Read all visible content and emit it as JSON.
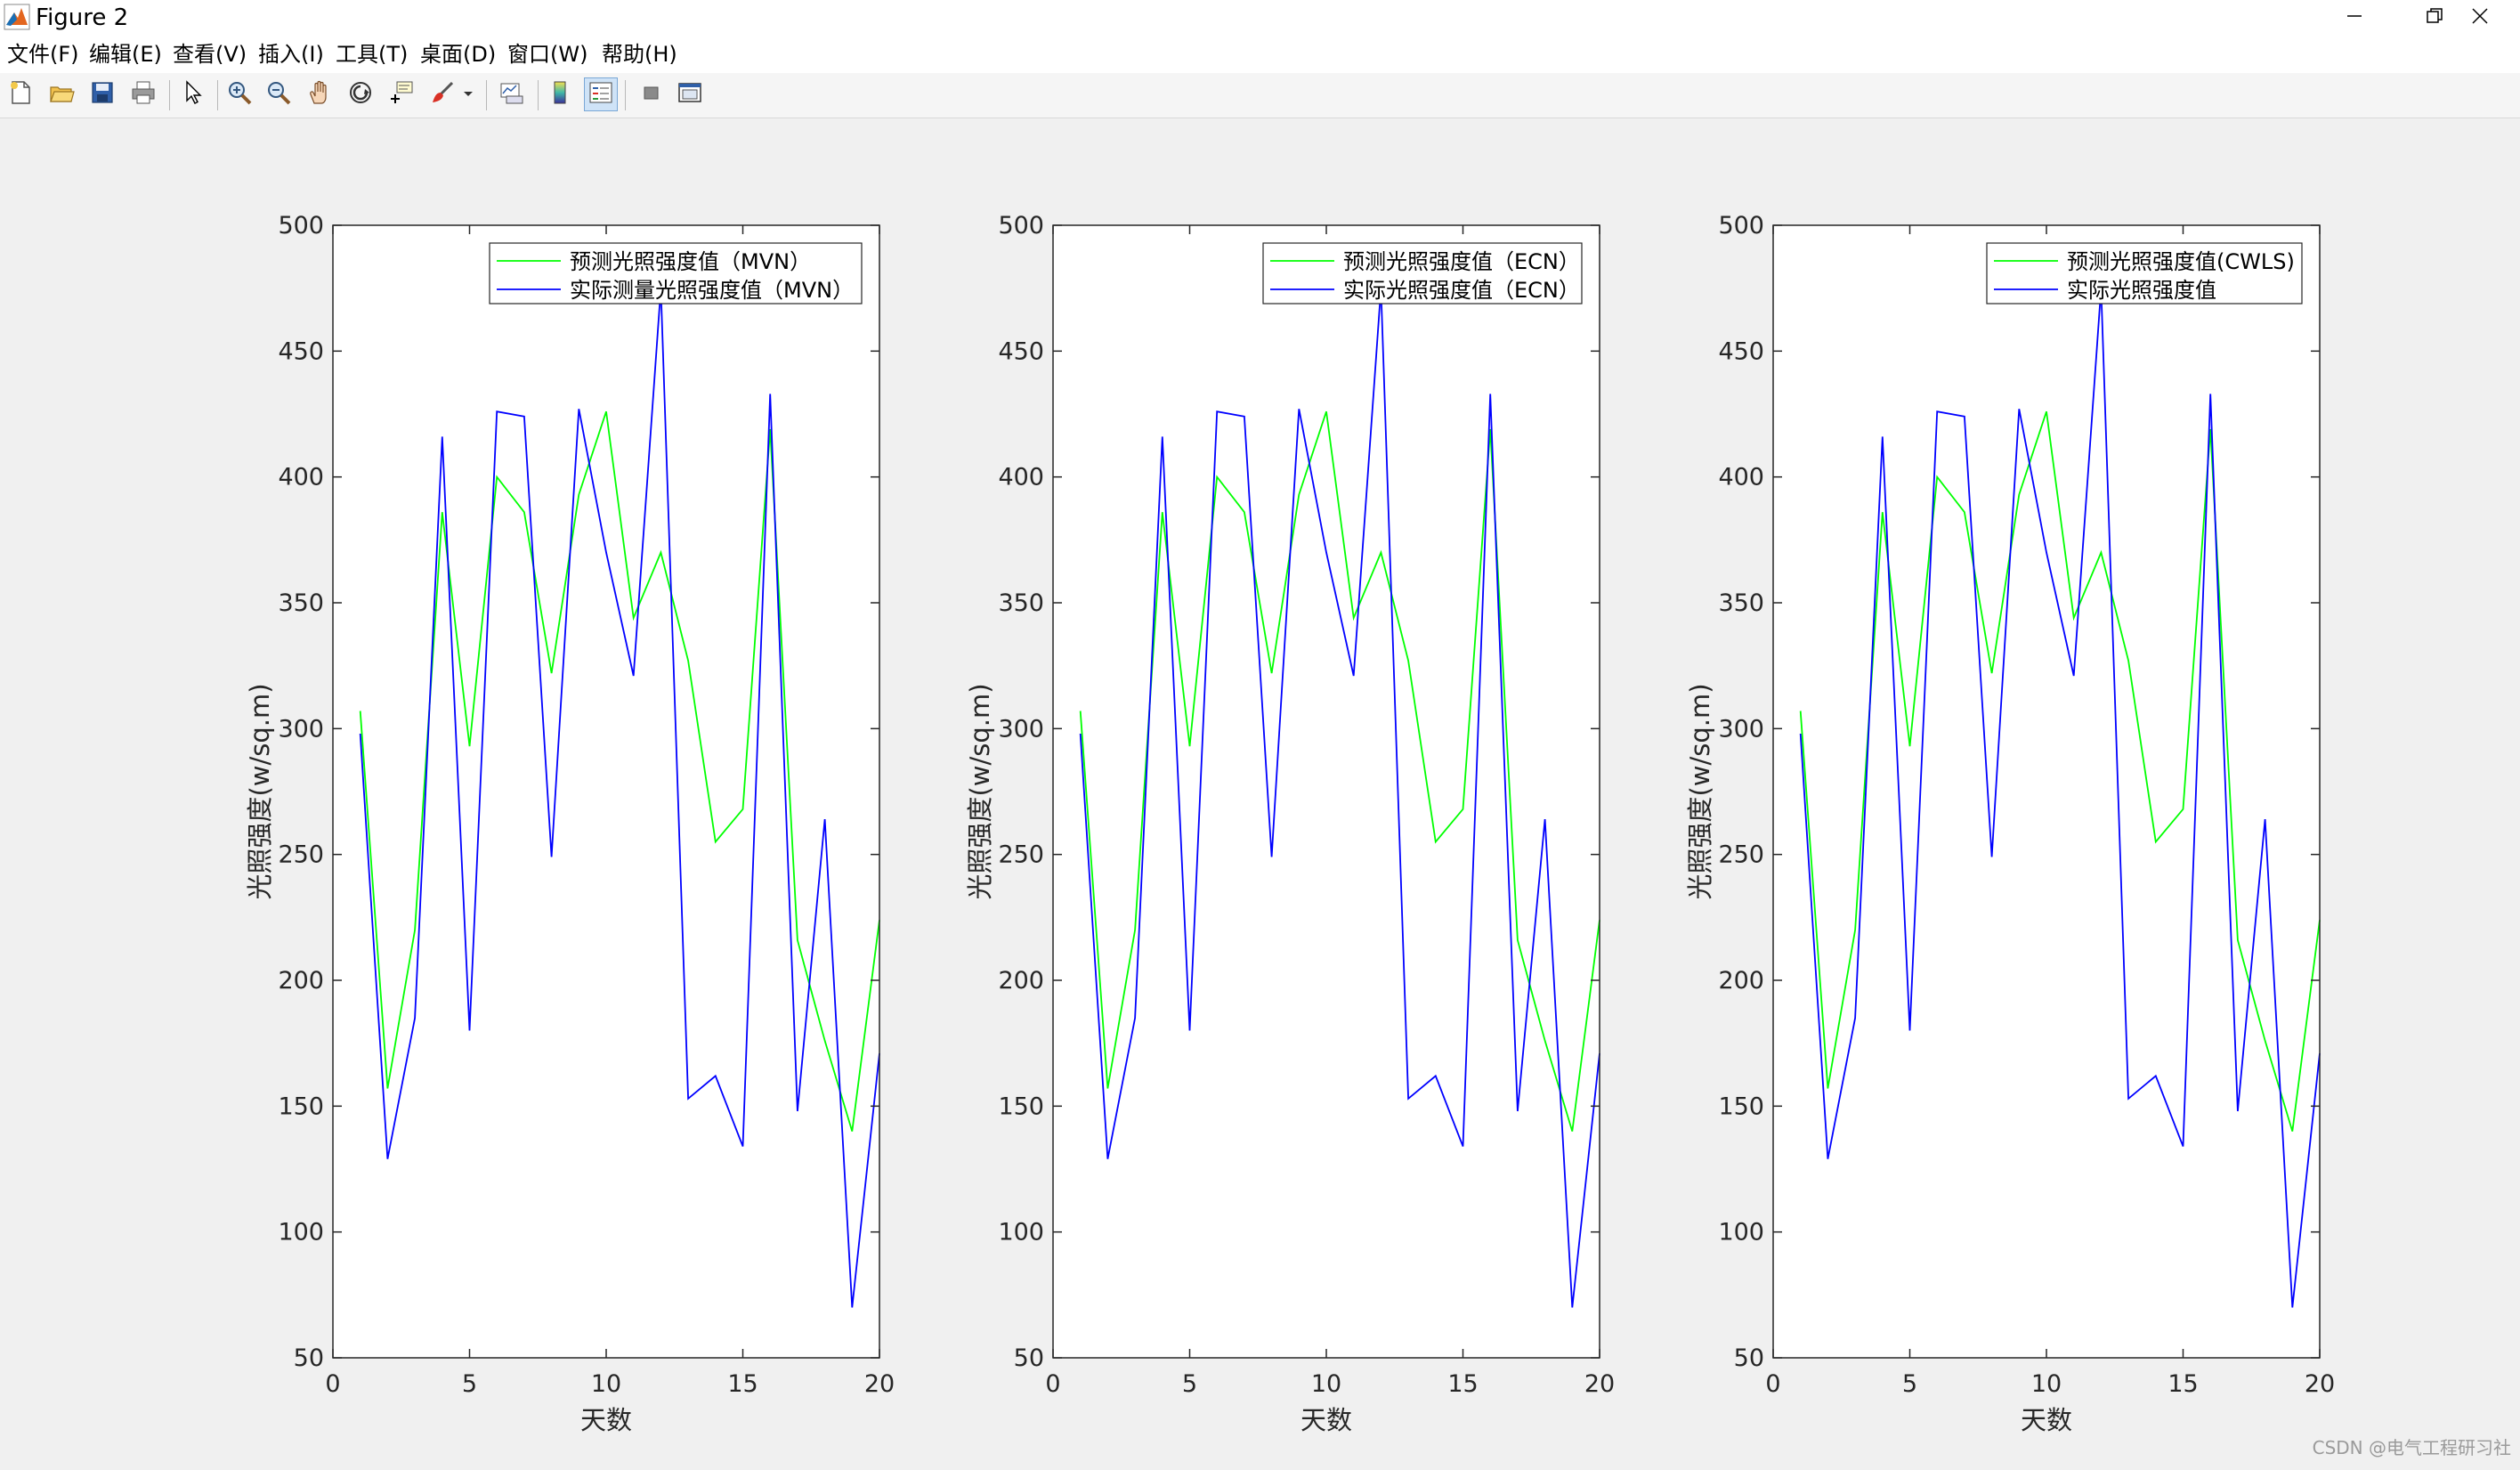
{
  "window": {
    "title": "Figure 2",
    "minimize_icon": "minimize-icon",
    "restore_icon": "restore-icon",
    "close_icon": "close-icon"
  },
  "menu": {
    "items": [
      "文件(F)",
      "编辑(E)",
      "查看(V)",
      "插入(I)",
      "工具(T)",
      "桌面(D)",
      "窗口(W)",
      "帮助(H)"
    ]
  },
  "toolbar": {
    "icons": [
      "new-figure-icon",
      "open-file-icon",
      "save-icon",
      "print-icon",
      "edit-plot-arrow-icon",
      "zoom-in-icon",
      "zoom-out-icon",
      "pan-hand-icon",
      "rotate-3d-icon",
      "data-cursor-icon",
      "brush-icon",
      "brush-dropdown-icon",
      "link-plot-icon",
      "colorbar-icon",
      "legend-icon",
      "hide-plot-tools-icon",
      "show-plot-tools-icon"
    ]
  },
  "watermark": "CSDN @电气工程研习社",
  "colors": {
    "predicted": "#00ff00",
    "actual": "#0000ff",
    "axes_bg": "#ffffff",
    "figure_bg": "#f0f0f0"
  },
  "chart_data": [
    {
      "type": "line",
      "xlabel": "天数",
      "ylabel": "光照强度(w/sq.m)",
      "xlim": [
        0,
        20
      ],
      "ylim": [
        50,
        500
      ],
      "xticks": [
        0,
        5,
        10,
        15,
        20
      ],
      "yticks": [
        50,
        100,
        150,
        200,
        250,
        300,
        350,
        400,
        450,
        500
      ],
      "grid": false,
      "legend_position": "top-right",
      "x": [
        1,
        2,
        3,
        4,
        5,
        6,
        7,
        8,
        9,
        10,
        11,
        12,
        13,
        14,
        15,
        16,
        17,
        18,
        19,
        20
      ],
      "series": [
        {
          "name": "预测光照强度值（MVN）",
          "color": "#00ff00",
          "values": [
            307,
            157,
            220,
            386,
            293,
            400,
            386,
            322,
            393,
            426,
            344,
            370,
            327,
            255,
            268,
            419,
            216,
            176,
            140,
            224
          ]
        },
        {
          "name": "实际测量光照强度值（MVN）",
          "color": "#0000ff",
          "values": [
            298,
            129,
            185,
            416,
            180,
            426,
            424,
            249,
            427,
            370,
            321,
            475,
            153,
            162,
            134,
            433,
            148,
            264,
            70,
            171
          ]
        }
      ]
    },
    {
      "type": "line",
      "xlabel": "天数",
      "ylabel": "光照强度(w/sq.m)",
      "xlim": [
        0,
        20
      ],
      "ylim": [
        50,
        500
      ],
      "xticks": [
        0,
        5,
        10,
        15,
        20
      ],
      "yticks": [
        50,
        100,
        150,
        200,
        250,
        300,
        350,
        400,
        450,
        500
      ],
      "grid": false,
      "legend_position": "top-right",
      "x": [
        1,
        2,
        3,
        4,
        5,
        6,
        7,
        8,
        9,
        10,
        11,
        12,
        13,
        14,
        15,
        16,
        17,
        18,
        19,
        20
      ],
      "series": [
        {
          "name": "预测光照强度值（ECN）",
          "color": "#00ff00",
          "values": [
            307,
            157,
            220,
            386,
            293,
            400,
            386,
            322,
            393,
            426,
            344,
            370,
            327,
            255,
            268,
            419,
            216,
            176,
            140,
            224
          ]
        },
        {
          "name": "实际光照强度值（ECN）",
          "color": "#0000ff",
          "values": [
            298,
            129,
            185,
            416,
            180,
            426,
            424,
            249,
            427,
            370,
            321,
            475,
            153,
            162,
            134,
            433,
            148,
            264,
            70,
            171
          ]
        }
      ]
    },
    {
      "type": "line",
      "xlabel": "天数",
      "ylabel": "光照强度(w/sq.m)",
      "xlim": [
        0,
        20
      ],
      "ylim": [
        50,
        500
      ],
      "xticks": [
        0,
        5,
        10,
        15,
        20
      ],
      "yticks": [
        50,
        100,
        150,
        200,
        250,
        300,
        350,
        400,
        450,
        500
      ],
      "grid": false,
      "legend_position": "top-right",
      "x": [
        1,
        2,
        3,
        4,
        5,
        6,
        7,
        8,
        9,
        10,
        11,
        12,
        13,
        14,
        15,
        16,
        17,
        18,
        19,
        20
      ],
      "series": [
        {
          "name": "预测光照强度值(CWLS)",
          "color": "#00ff00",
          "values": [
            307,
            157,
            220,
            386,
            293,
            400,
            386,
            322,
            393,
            426,
            344,
            370,
            327,
            255,
            268,
            419,
            216,
            176,
            140,
            224
          ]
        },
        {
          "name": "实际光照强度值",
          "color": "#0000ff",
          "values": [
            298,
            129,
            185,
            416,
            180,
            426,
            424,
            249,
            427,
            370,
            321,
            475,
            153,
            162,
            134,
            433,
            148,
            264,
            70,
            171
          ]
        }
      ]
    }
  ]
}
